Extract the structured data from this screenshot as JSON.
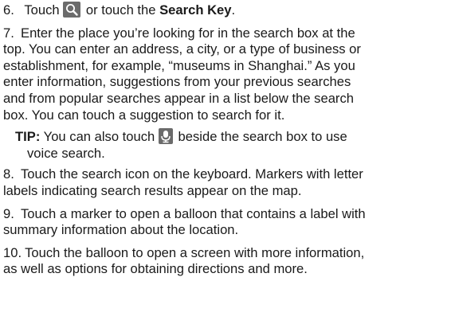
{
  "steps": {
    "s6": {
      "num": "6.",
      "pre": "Touch",
      "mid": "or touch the",
      "bold": "Search Key",
      "end": "."
    },
    "s7": {
      "num": "7.",
      "line1": "Enter the place you’re looking for in the search box at the",
      "line2": "top. You can enter an address, a city, or a type of business or",
      "line3": "establishment, for example, “museums in Shanghai.” As you",
      "line4": "enter information, suggestions from your previous searches",
      "line5": "and from popular searches appear in a list below the search",
      "line6": "box. You can touch a suggestion to search for it."
    },
    "tip": {
      "label": "TIP:",
      "pre": "You can also touch",
      "post": "beside the search box to use",
      "line2": "voice search."
    },
    "s8": {
      "num": "8.",
      "line1": "Touch the search icon on the keyboard. Markers with letter",
      "line2": "labels indicating search results appear on the map."
    },
    "s9": {
      "num": "9.",
      "line1": "Touch a marker to open a balloon that contains a label with",
      "line2": "summary information about the location."
    },
    "s10": {
      "num": "10.",
      "line1": "Touch the balloon to open a screen with more information,",
      "line2": "as well as options for obtaining directions and more."
    }
  },
  "icons": {
    "search": "search-icon",
    "microphone": "microphone-icon",
    "icon_bg": "#6b6b6b",
    "icon_fg": "#ffffff"
  }
}
